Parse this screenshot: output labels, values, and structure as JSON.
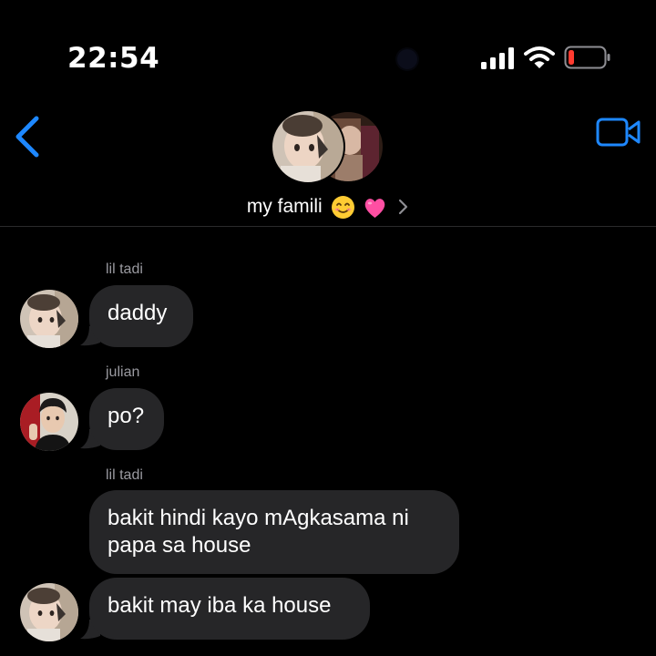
{
  "status_bar": {
    "time": "22:54",
    "icons": [
      "camera-dot",
      "cellular-signal-icon",
      "wifi-icon",
      "battery-low-icon"
    ],
    "battery_color": "#ff3b30"
  },
  "header": {
    "back_icon": "chevron-left-icon",
    "video_icon": "video-camera-icon",
    "accent_color": "#1e88ff",
    "group_name": "my famili",
    "group_name_emojis": [
      "smiling-face-emoji",
      "pink-heart-emoji"
    ],
    "chevron": "chevron-right-icon"
  },
  "messages": [
    {
      "sender": "lil tadi",
      "text": "daddy",
      "avatar": "toddler-avatar"
    },
    {
      "sender": "julian",
      "text": "po?",
      "avatar": "julian-avatar"
    },
    {
      "sender": "lil tadi",
      "lines": [
        "bakit hindi kayo mAgkasama ni",
        "papa sa house"
      ],
      "avatar": null
    },
    {
      "sender": null,
      "text": "bakit may iba ka house",
      "avatar": "toddler-avatar"
    }
  ],
  "colors": {
    "background": "#000000",
    "bubble": "#262628",
    "sender_label": "#9a9aa0"
  }
}
